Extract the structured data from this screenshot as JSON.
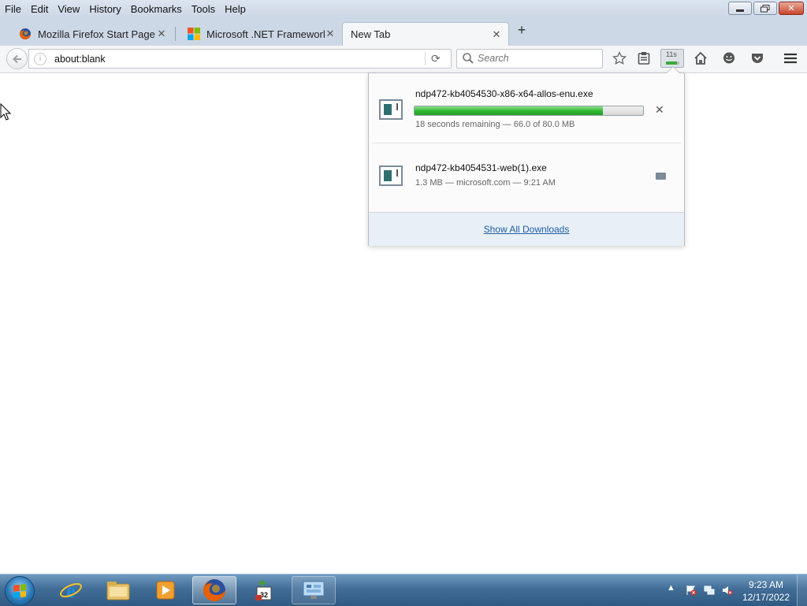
{
  "menu": {
    "items": [
      "File",
      "Edit",
      "View",
      "History",
      "Bookmarks",
      "Tools",
      "Help"
    ],
    "underline": [
      "F",
      "E",
      "V",
      "H",
      "B",
      "T",
      "H"
    ]
  },
  "window_controls": {
    "minimize": "▭",
    "restore": "❐",
    "close": "✕"
  },
  "tabs": [
    {
      "title": "Mozilla Firefox Start Page",
      "icon": "firefox-icon",
      "active": false
    },
    {
      "title": "Microsoft .NET Framework...",
      "icon": "microsoft-logo-icon",
      "active": false
    },
    {
      "title": "New Tab",
      "icon": "",
      "active": true
    }
  ],
  "navbar": {
    "url": "about:blank",
    "search_placeholder": "Search",
    "download_time": "11s",
    "download_progress": 0.82
  },
  "downloads": {
    "items": [
      {
        "filename": "ndp472-kb4054530-x86-x64-allos-enu.exe",
        "status": "18 seconds remaining — 66.0 of 80.0 MB",
        "progress": 0.825,
        "state": "downloading"
      },
      {
        "filename": "ndp472-kb4054531-web(1).exe",
        "status": "1.3 MB — microsoft.com — 9:21 AM",
        "state": "completed"
      }
    ],
    "show_all_label": "Show All Downloads"
  },
  "taskbar": {
    "apps": [
      "internet-explorer-icon",
      "windows-explorer-icon",
      "media-player-icon",
      "firefox-icon",
      "installer-32-icon",
      "control-panel-icon"
    ],
    "installer_badge": "32",
    "time": "9:23 AM",
    "date": "12/17/2022"
  },
  "colors": {
    "progress_green": "#2fb52f",
    "link_blue": "#1d5fa6",
    "taskbar_blue": "#416d97"
  }
}
